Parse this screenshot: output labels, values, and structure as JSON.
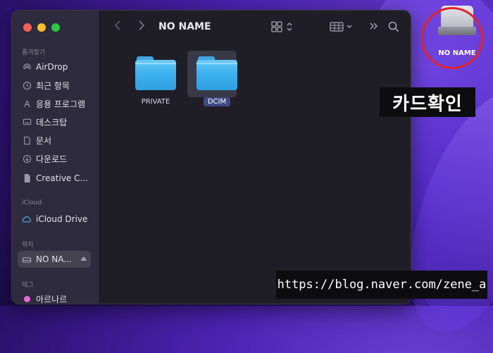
{
  "window": {
    "title": "NO NAME",
    "nav": {
      "back_icon": "chevron-left-icon",
      "forward_icon": "chevron-right-icon"
    }
  },
  "sidebar": {
    "favorites_title": "즐겨찾기",
    "favorites": [
      {
        "label": "AirDrop",
        "icon": "airdrop-icon"
      },
      {
        "label": "최근 항목",
        "icon": "clock-icon"
      },
      {
        "label": "응용 프로그램",
        "icon": "apps-icon"
      },
      {
        "label": "데스크탑",
        "icon": "desktop-icon"
      },
      {
        "label": "문서",
        "icon": "document-icon"
      },
      {
        "label": "다운로드",
        "icon": "download-icon"
      },
      {
        "label": "Creative C...",
        "icon": "file-icon"
      }
    ],
    "icloud_title": "iCloud",
    "icloud": [
      {
        "label": "iCloud Drive",
        "icon": "cloud-icon"
      }
    ],
    "locations_title": "위치",
    "locations": [
      {
        "label": "NO NA...",
        "icon": "drive-icon",
        "selected": true
      }
    ],
    "tags_title": "태그",
    "tags": [
      {
        "label": "아르나르",
        "color": "#e86ad8"
      }
    ]
  },
  "files": [
    {
      "name": "PRIVATE",
      "selected": false
    },
    {
      "name": "DCIM",
      "selected": true
    }
  ],
  "desktop": {
    "drive_label": "NO NAME",
    "caption": "카드확인",
    "watermark": "https://blog.naver.com/zene_a"
  },
  "colors": {
    "folder": "#3fb3f0",
    "selection": "#3f4a86",
    "annotation": "#e0232b"
  }
}
